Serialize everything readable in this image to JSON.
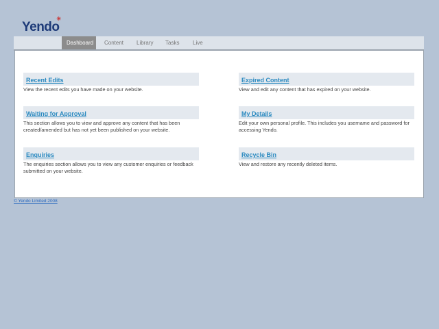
{
  "logo": {
    "text": "Yendo"
  },
  "nav": {
    "tabs": [
      {
        "label": "Dashboard",
        "active": true
      },
      {
        "label": "Content"
      },
      {
        "label": "Library"
      },
      {
        "label": "Tasks"
      },
      {
        "label": "Live"
      }
    ]
  },
  "sections": [
    {
      "title": "Recent Edits",
      "desc": "View the recent edits you have made on your website."
    },
    {
      "title": "Expired Content",
      "desc": "View and edit any content that has expired on your website."
    },
    {
      "title": "Waiting for Approval",
      "desc": "This section allows you to view and approve any content that has been created/amended but has not yet been published on your website."
    },
    {
      "title": "My Details",
      "desc": "Edit your own personal profile. This includes you username and password for accessing Yendo."
    },
    {
      "title": "Enquiries",
      "desc": "The enquiries section allows you to view any customer enquiries or feedback submitted on your website."
    },
    {
      "title": "Recycle Bin",
      "desc": "View and restore any recently deleted items."
    }
  ],
  "footer": {
    "text": "© Yendo Limited 2008"
  }
}
